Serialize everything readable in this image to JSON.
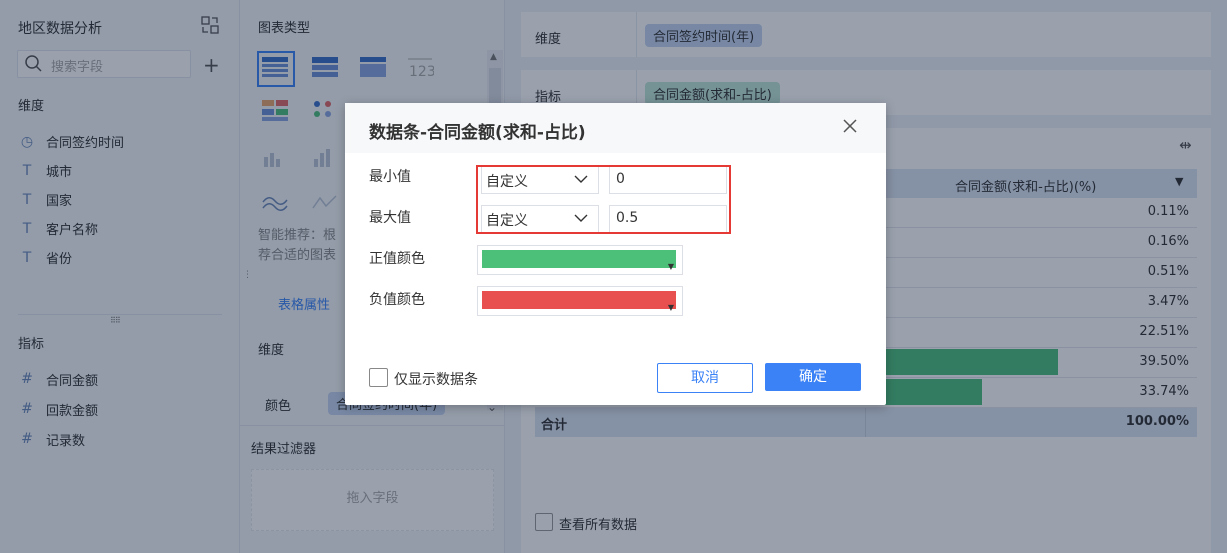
{
  "left_panel": {
    "title": "地区数据分析",
    "search_placeholder": "搜索字段",
    "dimension_header": "维度",
    "dimensions": [
      "合同签约时间",
      "城市",
      "国家",
      "客户名称",
      "省份"
    ],
    "metric_header": "指标",
    "metrics": [
      "合同金额",
      "回款金额",
      "记录数"
    ]
  },
  "mid_panel": {
    "chart_type_header": "图表类型",
    "smart_tip_line1": "智能推荐：根",
    "smart_tip_line2": "荐合适的图表",
    "table_props_tab": "表格属性",
    "dimension_label": "维度",
    "color_label": "颜色",
    "color_pill": "合同签约时间(年)",
    "result_filter_header": "结果过滤器",
    "drop_hint": "拖入字段"
  },
  "right_panel": {
    "dimension_label": "维度",
    "dimension_pill": "合同签约时间(年)",
    "metric_label": "指标",
    "metric_pill": "合同金额(求和-占比)",
    "table": {
      "column_header": "合同金额(求和-占比)(%)",
      "rows": [
        {
          "value": "0.11%",
          "fraction": 0
        },
        {
          "value": "0.16%",
          "fraction": 0
        },
        {
          "value": "0.51%",
          "fraction": 0
        },
        {
          "value": "3.47%",
          "fraction": 0.0694
        },
        {
          "value": "22.51%",
          "fraction": 0.4502
        },
        {
          "value": "39.50%",
          "fraction": 0.79
        },
        {
          "value": "33.74%",
          "fraction": 0.6748
        }
      ],
      "total_label": "合计",
      "total_value": "100.00%"
    },
    "view_all_label": "查看所有数据"
  },
  "dialog": {
    "title": "数据条-合同金额(求和-占比)",
    "min_label": "最小值",
    "max_label": "最大值",
    "min_mode": "自定义",
    "max_mode": "自定义",
    "min_value": "0",
    "max_value": "0.5",
    "positive_color_label": "正值颜色",
    "negative_color_label": "负值颜色",
    "positive_color": "#4cbf78",
    "negative_color": "#e84f4f",
    "only_bar_label": "仅显示数据条",
    "cancel_label": "取消",
    "ok_label": "确定"
  },
  "colors": {
    "accent": "#3b82f6",
    "highlight_box": "#e53935",
    "bar_green": "#4fbf7c"
  }
}
